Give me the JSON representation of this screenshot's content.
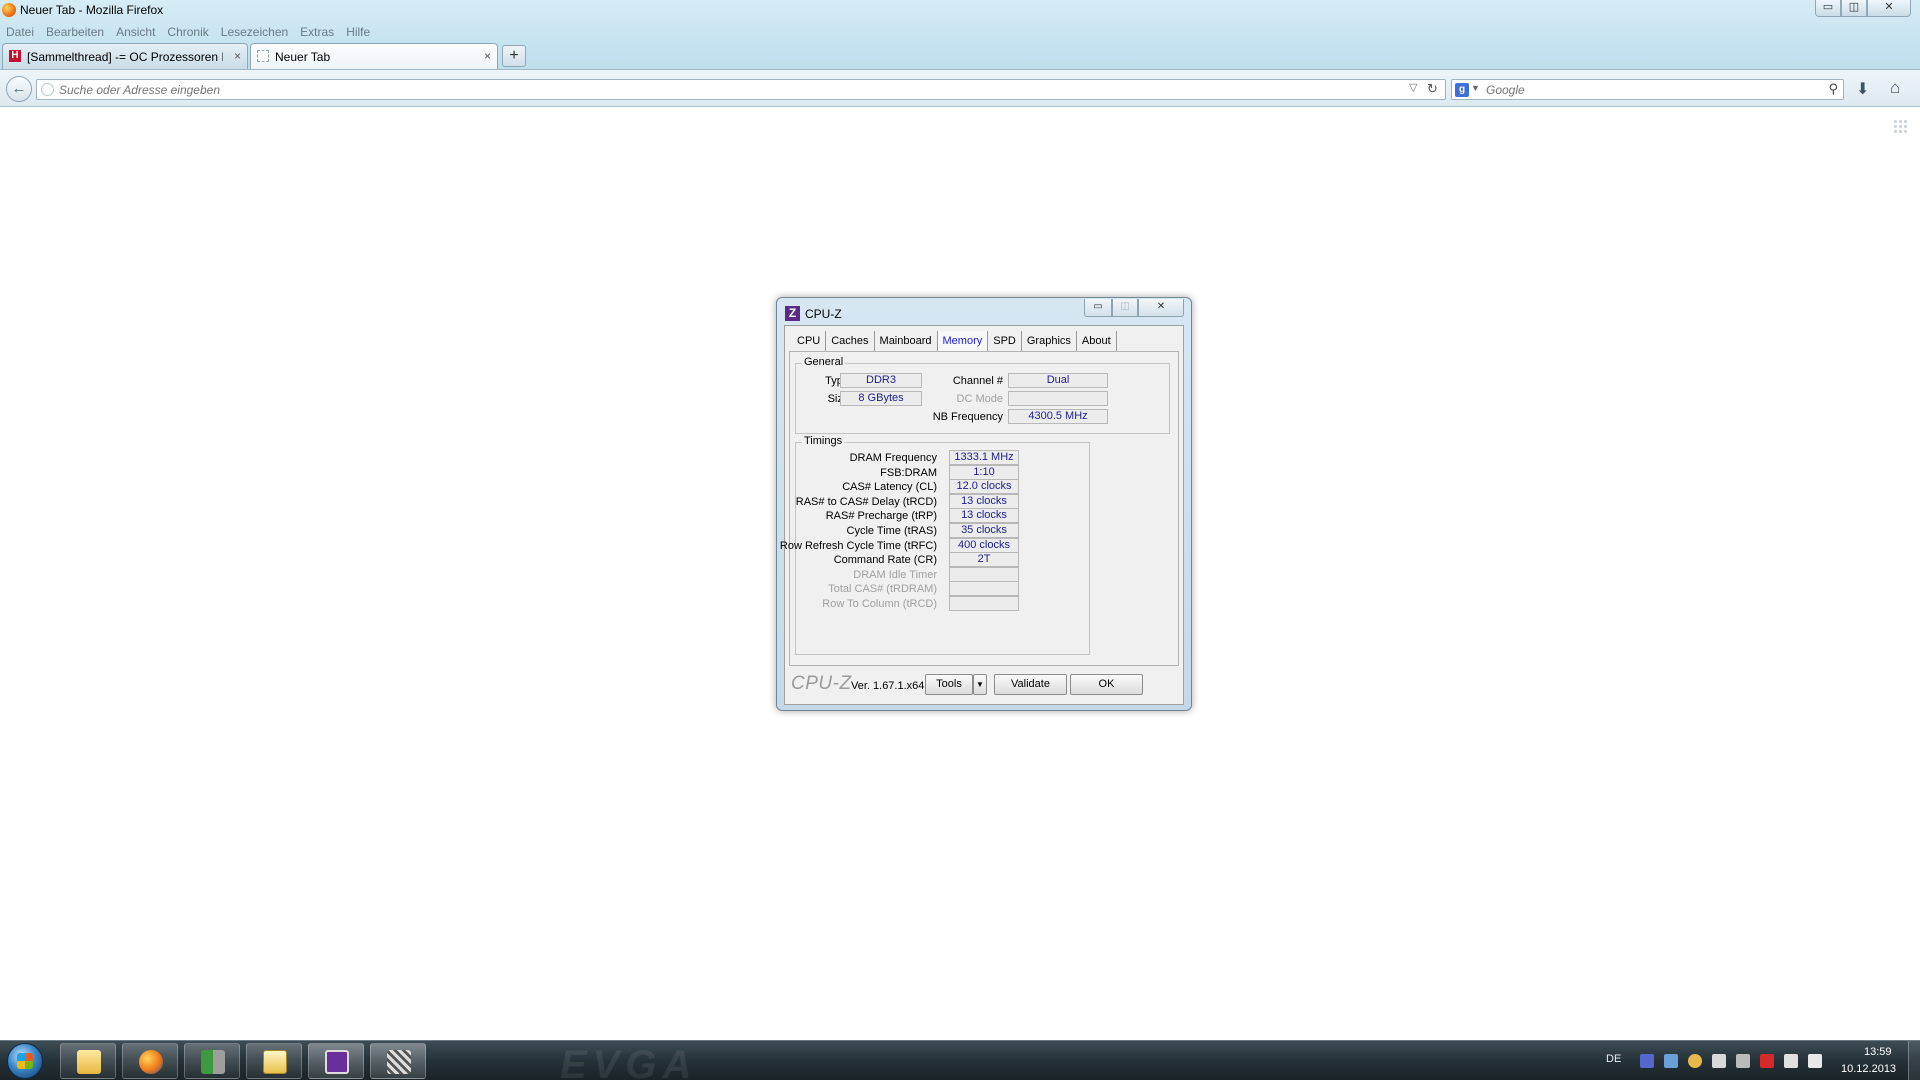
{
  "firefox": {
    "window_title": "Neuer Tab - Mozilla Firefox",
    "window_controls": {
      "minimize": "▭",
      "maximize": "◫",
      "close": "✕"
    },
    "menu": [
      "Datei",
      "Bearbeiten",
      "Ansicht",
      "Chronik",
      "Lesezeichen",
      "Extras",
      "Hilfe"
    ],
    "tabs": [
      {
        "label": "[Sammelthread] -= OC Prozessoren I...",
        "favicon": "H",
        "close": "×"
      },
      {
        "label": "Neuer Tab",
        "close": "×"
      }
    ],
    "new_tab_label": "+",
    "back_label": "←",
    "url_placeholder": "Suche oder Adresse eingeben",
    "url_dropdown": "▽",
    "reload_label": "↻",
    "search_engine_letter": "g",
    "search_placeholder": "Google",
    "search_go": "⚲",
    "download_label": "⬇",
    "home_label": "⌂"
  },
  "cpuz": {
    "title": "CPU-Z",
    "icon_letter": "Z",
    "window_controls": {
      "minimize": "▭",
      "maximize": "◫",
      "close": "✕"
    },
    "tabs": [
      "CPU",
      "Caches",
      "Mainboard",
      "Memory",
      "SPD",
      "Graphics",
      "About"
    ],
    "active_tab": "Memory",
    "general": {
      "title": "General",
      "type_label": "Type",
      "type_value": "DDR3",
      "size_label": "Size",
      "size_value": "8 GBytes",
      "channel_label": "Channel #",
      "channel_value": "Dual",
      "dcmode_label": "DC Mode",
      "dcmode_value": "",
      "nbfreq_label": "NB Frequency",
      "nbfreq_value": "4300.5 MHz"
    },
    "timings": {
      "title": "Timings",
      "rows": [
        {
          "label": "DRAM Frequency",
          "value": "1333.1 MHz",
          "enabled": true
        },
        {
          "label": "FSB:DRAM",
          "value": "1:10",
          "enabled": true
        },
        {
          "label": "CAS# Latency (CL)",
          "value": "12.0 clocks",
          "enabled": true
        },
        {
          "label": "RAS# to CAS# Delay (tRCD)",
          "value": "13 clocks",
          "enabled": true
        },
        {
          "label": "RAS# Precharge (tRP)",
          "value": "13 clocks",
          "enabled": true
        },
        {
          "label": "Cycle Time (tRAS)",
          "value": "35 clocks",
          "enabled": true
        },
        {
          "label": "Row Refresh Cycle Time (tRFC)",
          "value": "400 clocks",
          "enabled": true
        },
        {
          "label": "Command Rate (CR)",
          "value": "2T",
          "enabled": true
        },
        {
          "label": "DRAM Idle Timer",
          "value": "",
          "enabled": false
        },
        {
          "label": "Total CAS# (tRDRAM)",
          "value": "",
          "enabled": false
        },
        {
          "label": "Row To Column (tRCD)",
          "value": "",
          "enabled": false
        }
      ]
    },
    "footer": {
      "brand": "CPU-Z",
      "version": "Ver. 1.67.1.x64",
      "tools_label": "Tools",
      "tools_dropdown": "▼",
      "validate_label": "Validate",
      "ok_label": "OK"
    }
  },
  "taskbar": {
    "wallpaper_text": "EVGA",
    "tray": {
      "language": "DE",
      "time": "13:59",
      "date": "10.12.2013"
    }
  }
}
